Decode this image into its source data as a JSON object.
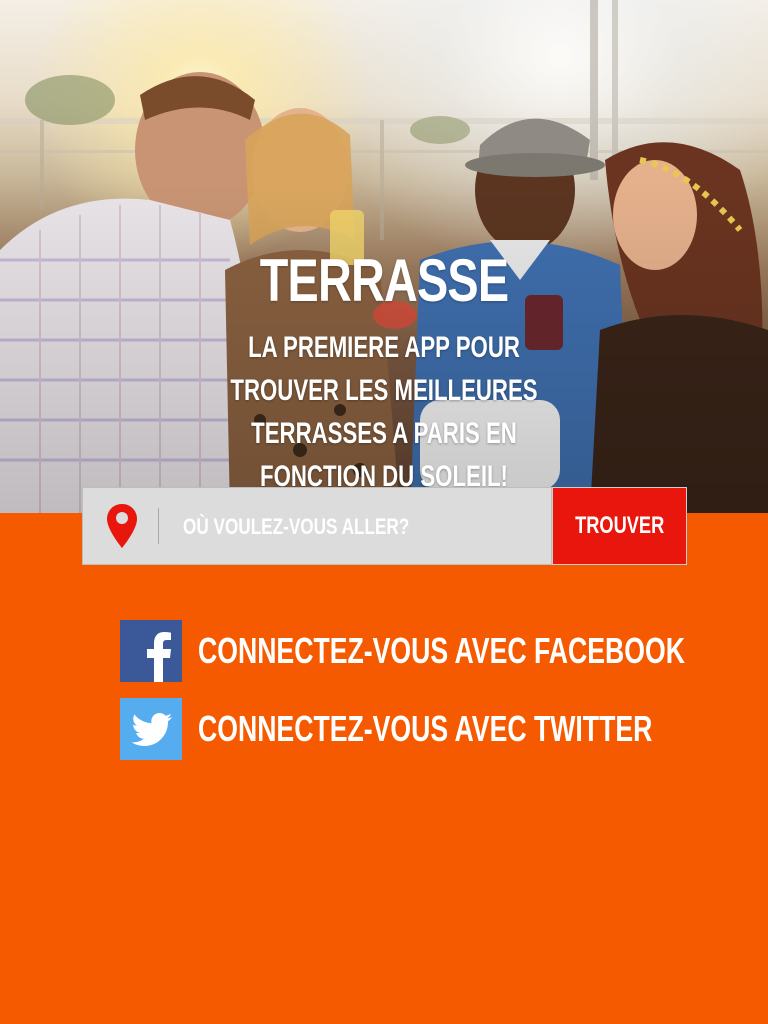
{
  "hero": {
    "title": "TERRASSE",
    "tagline": "LA PREMIERE APP POUR TROUVER LES MEILLEURES TERRASSES A PARIS EN FONCTION DU SOLEIL!"
  },
  "search": {
    "placeholder": "OÙ VOULEZ-VOUS ALLER?",
    "button_label": "TROUVER",
    "pin_icon": "map-pin-icon"
  },
  "social": [
    {
      "label": "CONNECTEZ-VOUS AVEC FACEBOOK",
      "icon": "facebook-icon"
    },
    {
      "label": "CONNECTEZ-VOUS AVEC TWITTER",
      "icon": "twitter-icon"
    }
  ],
  "colors": {
    "background": "#f65a00",
    "button": "#e8160c",
    "search_field": "#dcdcdc",
    "facebook": "#3b5998",
    "twitter": "#55acee",
    "pin": "#e8160c"
  }
}
